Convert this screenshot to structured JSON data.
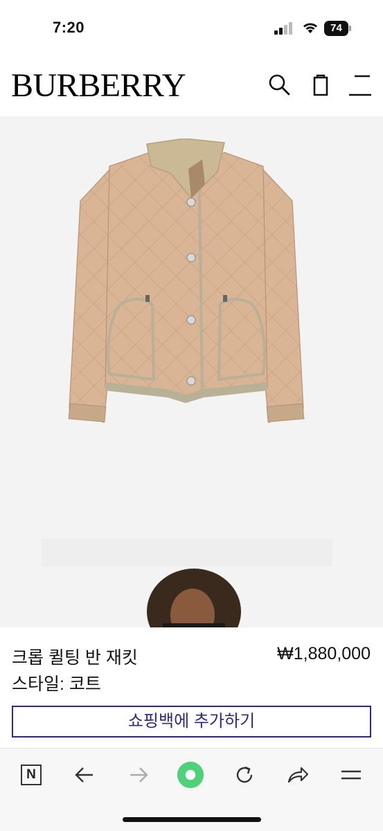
{
  "status_bar": {
    "time": "7:20",
    "battery": "74",
    "icons": [
      "signal-icon",
      "wifi-icon",
      "battery-icon"
    ]
  },
  "header": {
    "logo": "BURBERRY",
    "icons": [
      "search-icon",
      "shopping-bag-icon",
      "menu-icon"
    ]
  },
  "hero": {
    "images": [
      "product-image-jacket",
      "model-image"
    ]
  },
  "product": {
    "name": "크롭 퀼팅 반 재킷",
    "price": "₩1,880,000",
    "style": "스타일: 코트",
    "add_to_bag_label": "쇼핑백에 추가하기"
  },
  "browser_bar": {
    "n_label": "N",
    "icons": [
      "naver-n-icon",
      "back-arrow-icon",
      "forward-arrow-icon",
      "green-home-icon",
      "reload-icon",
      "share-icon",
      "more-menu-icon"
    ]
  },
  "colors": {
    "accent": "#2b2a7d",
    "hero_bg": "#f3f3f3",
    "jacket": "#d9b596",
    "green_button": "#4fd17a"
  }
}
